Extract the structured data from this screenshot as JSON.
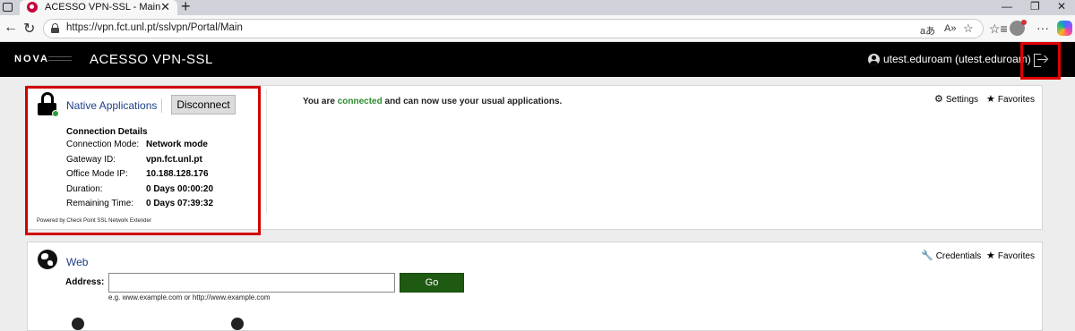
{
  "browser": {
    "tab_title": "ACESSO VPN-SSL - Main",
    "url": "https://vpn.fct.unl.pt/sslvpn/Portal/Main"
  },
  "header": {
    "logo": "NOVA",
    "app_title": "ACESSO VPN-SSL",
    "user": "utest.eduroam (utest.eduroam)"
  },
  "native_apps": {
    "title": "Native Applications",
    "disconnect_label": "Disconnect",
    "details_title": "Connection Details",
    "details": [
      {
        "label": "Connection Mode:",
        "value": "Network mode"
      },
      {
        "label": "Gateway ID:",
        "value": "vpn.fct.unl.pt"
      },
      {
        "label": "Office Mode IP:",
        "value": "10.188.128.176"
      },
      {
        "label": "Duration:",
        "value": "0 Days 00:00:20"
      },
      {
        "label": "Remaining Time:",
        "value": "0 Days 07:39:32"
      }
    ],
    "powered_by": "Powered by Check Point SSL Network Extender",
    "status_prefix": "You are",
    "status_word": "connected",
    "status_suffix": "and can now use your usual applications.",
    "settings_label": "Settings",
    "favorites_label": "Favorites"
  },
  "web": {
    "title": "Web",
    "address_label": "Address:",
    "address_value": "",
    "go_label": "Go",
    "hint": "e.g.  www.example.com  or  http://www.example.com",
    "credentials_label": "Credentials",
    "favorites_label": "Favorites"
  },
  "colors": {
    "link_blue": "#1f3f8a",
    "connected_green": "#2e8b2e",
    "go_green": "#1f5a12",
    "highlight_red": "#d00000"
  }
}
